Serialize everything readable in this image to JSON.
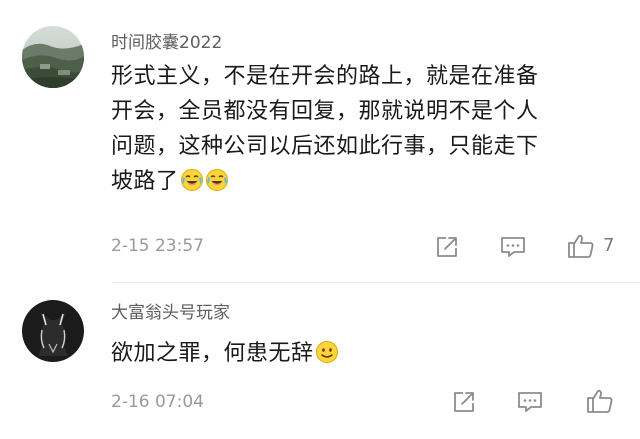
{
  "comments": [
    {
      "username": "时间胶囊2022",
      "lines": [
        "形式主义，不是在开会的路上，就是在准备",
        "开会，全员都没有回复，那就说明不是个人",
        "问题，这种公司以后还如此行事，只能走下",
        "坡路了"
      ],
      "emojis": [
        "crying-laughing",
        "crying-laughing"
      ],
      "time": "2-15 23:57",
      "like_count": "7",
      "avatar": "landscape-photo"
    },
    {
      "username": "大富翁头号玩家",
      "lines": [
        "欲加之罪，何患无辞"
      ],
      "emojis": [
        "smiling-face"
      ],
      "time": "2-16 07:04",
      "like_count": "",
      "avatar": "dark-cat-silhouette"
    }
  ],
  "icons": {
    "share": "share-icon",
    "reply": "reply-icon",
    "like": "thumbs-up-icon"
  },
  "colors": {
    "text": "#1a1a1a",
    "username": "#5e5e5e",
    "meta": "#9a9a9a",
    "icon": "#8c8c8c"
  }
}
